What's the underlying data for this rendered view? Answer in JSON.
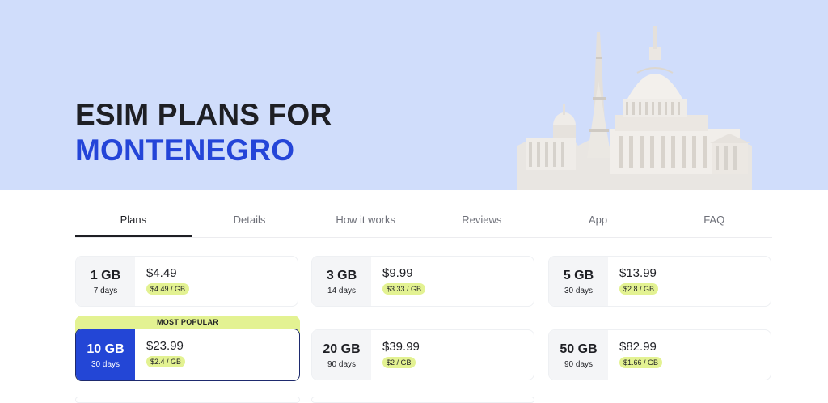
{
  "hero": {
    "title_line1": "ESIM PLANS FOR",
    "title_line2": "MONTENEGRO",
    "illustration": "landmarks-monument-illustration"
  },
  "tabs": [
    {
      "label": "Plans",
      "active": true
    },
    {
      "label": "Details"
    },
    {
      "label": "How it works"
    },
    {
      "label": "Reviews"
    },
    {
      "label": "App"
    },
    {
      "label": "FAQ"
    }
  ],
  "popular_label": "MOST POPULAR",
  "plans": [
    {
      "data": "1 GB",
      "days": "7 days",
      "price": "$4.49",
      "per_gb": "$4.49 / GB"
    },
    {
      "data": "3 GB",
      "days": "14 days",
      "price": "$9.99",
      "per_gb": "$3.33 / GB"
    },
    {
      "data": "5 GB",
      "days": "30 days",
      "price": "$13.99",
      "per_gb": "$2.8 / GB"
    },
    {
      "data": "10 GB",
      "days": "30 days",
      "price": "$23.99",
      "per_gb": "$2.4 / GB"
    },
    {
      "data": "20 GB",
      "days": "90 days",
      "price": "$39.99",
      "per_gb": "$2 / GB"
    },
    {
      "data": "50 GB",
      "days": "90 days",
      "price": "$82.99",
      "per_gb": "$1.66 / GB"
    }
  ],
  "colors": {
    "hero_bg": "#d0ddfb",
    "accent_blue": "#2346d6",
    "highlight_lime": "#e3f292",
    "text_dark": "#1e1f24"
  }
}
